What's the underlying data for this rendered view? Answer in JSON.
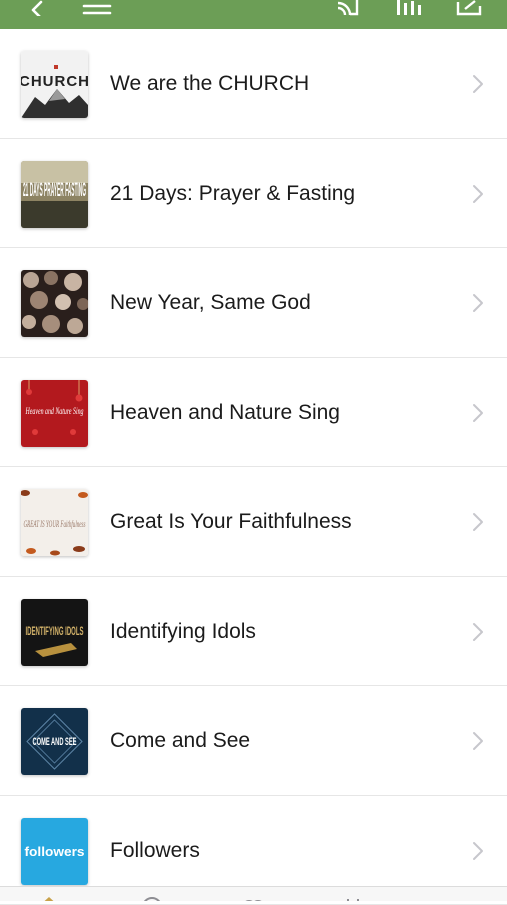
{
  "colors": {
    "header_bg": "#6c9e56",
    "chevron": "#c7c7cc",
    "divider": "#e6e6e6"
  },
  "header": {
    "icons": [
      "back-icon",
      "menu-icon",
      "cast-icon",
      "audio-icon",
      "share-icon"
    ]
  },
  "series": [
    {
      "title": "We are the CHURCH",
      "thumbnail_text": "CHURCH"
    },
    {
      "title": "21 Days: Prayer & Fasting",
      "thumbnail_text": "21 DAYS PRAYER FASTING"
    },
    {
      "title": "New Year, Same God"
    },
    {
      "title": "Heaven and Nature Sing",
      "thumbnail_text": "Heaven and Nature Sing"
    },
    {
      "title": "Great Is Your Faithfulness",
      "thumbnail_text": "GREAT IS YOUR Faithfulness"
    },
    {
      "title": "Identifying Idols",
      "thumbnail_text": "IDENTIFYING IDOLS"
    },
    {
      "title": "Come and See",
      "thumbnail_text": "COME AND SEE"
    },
    {
      "title": "Followers",
      "thumbnail_text": "followers"
    }
  ],
  "tabbar": {
    "icons": [
      "home-icon",
      "search-icon",
      "people-icon",
      "bookmark-icon"
    ]
  }
}
